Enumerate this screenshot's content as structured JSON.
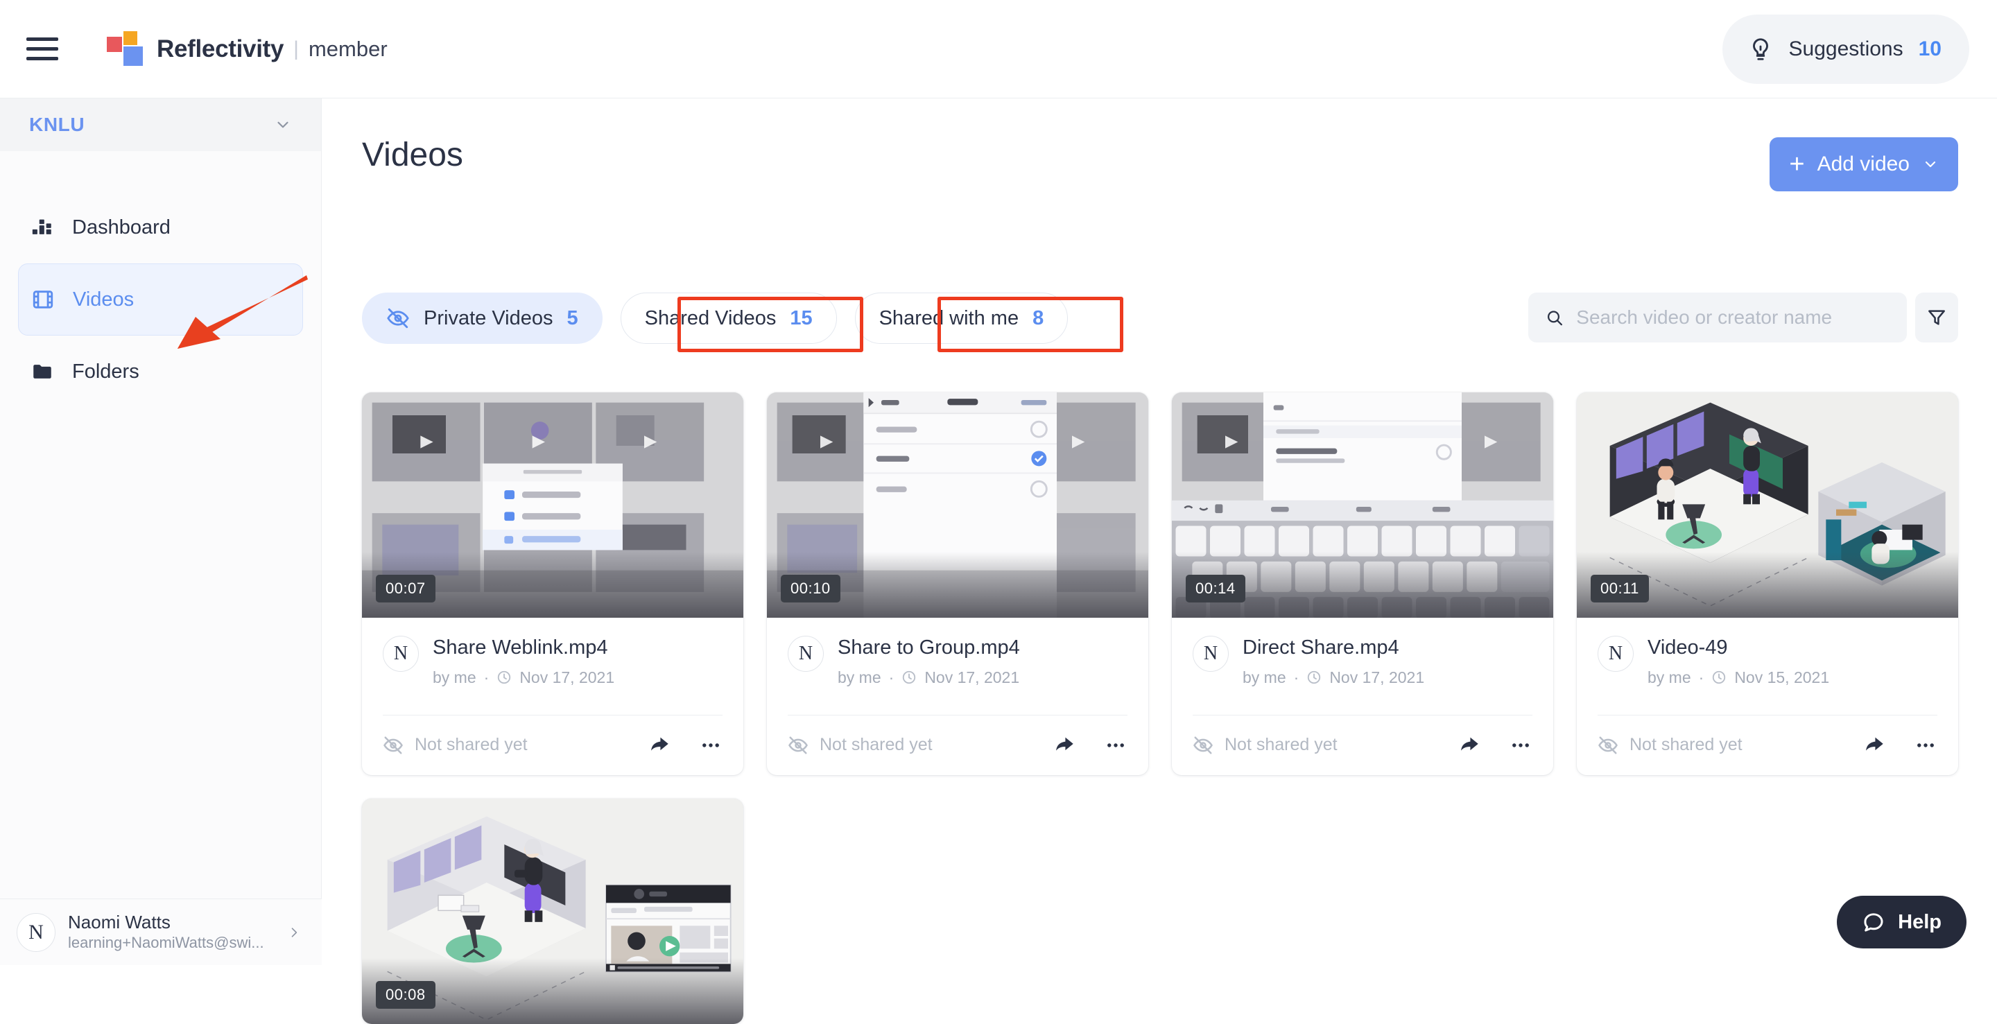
{
  "topbar": {
    "menu_icon": "hamburger-icon",
    "brand_name": "Reflectivity",
    "brand_separator": "|",
    "brand_role": "member",
    "suggestions": {
      "icon": "lightbulb-icon",
      "label": "Suggestions",
      "count": "10"
    }
  },
  "sidebar": {
    "workspace": {
      "name": "KNLU",
      "icon": "chevron-down-icon"
    },
    "items": [
      {
        "label": "Dashboard",
        "icon": "dashboard-icon",
        "active": false
      },
      {
        "label": "Videos",
        "icon": "film-icon",
        "active": true
      },
      {
        "label": "Folders",
        "icon": "folder-icon",
        "active": false
      }
    ],
    "profile": {
      "avatar_letter": "N",
      "name": "Naomi Watts",
      "email": "learning+NaomiWatts@swi...",
      "chevron": "chevron-right-icon"
    }
  },
  "main": {
    "page_title": "Videos",
    "add_video": {
      "label": "Add video",
      "plus": "+",
      "chevron": "chevron-down-icon"
    },
    "tabs": [
      {
        "label": "Private Videos",
        "count": "5",
        "active": true,
        "icon": "eye-off-icon"
      },
      {
        "label": "Shared Videos",
        "count": "15",
        "active": false,
        "icon": ""
      },
      {
        "label": "Shared with me",
        "count": "8",
        "active": false,
        "icon": ""
      }
    ],
    "search": {
      "placeholder": "Search video or creator name",
      "value": "",
      "icon": "search-icon"
    },
    "filter": {
      "icon": "filter-funnel-icon"
    },
    "cards": [
      {
        "title": "Share Weblink.mp4",
        "author": "by me",
        "separator": "·",
        "date": "Nov 17, 2021",
        "duration": "00:07",
        "avatar_letter": "N",
        "share_state": "Not shared yet",
        "share_icon": "share-arrow-icon",
        "more_icon": "more-horizontal-icon",
        "thumb": "share-options-menu"
      },
      {
        "title": "Share to Group.mp4",
        "author": "by me",
        "separator": "·",
        "date": "Nov 17, 2021",
        "duration": "00:10",
        "avatar_letter": "N",
        "share_state": "Not shared yet",
        "share_icon": "share-arrow-icon",
        "more_icon": "more-horizontal-icon",
        "thumb": "groups-panel"
      },
      {
        "title": "Direct Share.mp4",
        "author": "by me",
        "separator": "·",
        "date": "Nov 17, 2021",
        "duration": "00:14",
        "avatar_letter": "N",
        "share_state": "Not shared yet",
        "share_icon": "share-arrow-icon",
        "more_icon": "more-horizontal-icon",
        "thumb": "mobile-keyboard"
      },
      {
        "title": "Video-49",
        "author": "by me",
        "separator": "·",
        "date": "Nov 15, 2021",
        "duration": "00:11",
        "avatar_letter": "N",
        "share_state": "Not shared yet",
        "share_icon": "share-arrow-icon",
        "more_icon": "more-horizontal-icon",
        "thumb": "isometric-office"
      },
      {
        "title": "",
        "author": "",
        "separator": "",
        "date": "",
        "duration": "00:08",
        "avatar_letter": "",
        "share_state": "",
        "share_icon": "",
        "more_icon": "",
        "thumb": "isometric-studio"
      }
    ]
  },
  "help": {
    "label": "Help",
    "icon": "chat-bubble-icon"
  },
  "annotations": {
    "accent_color": "#ee3b1f",
    "boxes": [
      "private-videos-tab",
      "shared-videos-tab"
    ],
    "arrow_target": "sidebar-item-videos"
  },
  "colors": {
    "brand_blue": "#6b93f0",
    "accent_red": "#ee3b1f",
    "text_dark": "#2b3245",
    "text_muted": "#a5abb7"
  }
}
